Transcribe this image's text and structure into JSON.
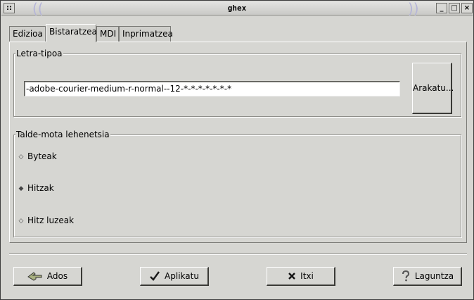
{
  "window": {
    "title": "ghex"
  },
  "titlebar": {
    "menu_glyph": "::",
    "minimize_glyph": "_",
    "maximize_glyph": "□",
    "close_glyph": "×"
  },
  "tabs": [
    {
      "label": "Edizioa",
      "active": false
    },
    {
      "label": "Bistaratzea",
      "active": true
    },
    {
      "label": "MDI",
      "active": false
    },
    {
      "label": "Inprimatzea",
      "active": false
    }
  ],
  "font_section": {
    "title": "Letra-tipoa",
    "font_value": "-adobe-courier-medium-r-normal--12-*-*-*-*-*-*-*",
    "browse_label": "Arakatu..."
  },
  "group_section": {
    "title": "Talde-mota lehenetsia",
    "options": [
      {
        "label": "Byteak",
        "selected": false
      },
      {
        "label": "Hitzak",
        "selected": true
      },
      {
        "label": "Hitz luzeak",
        "selected": false
      }
    ]
  },
  "buttons": {
    "ok": {
      "label": "Ados",
      "icon": "hand-pointing-icon"
    },
    "apply": {
      "label": "Aplikatu",
      "icon": "checkmark-icon"
    },
    "close": {
      "label": "Itxi",
      "icon": "x-icon"
    },
    "help": {
      "label": "Laguntza",
      "icon": "question-icon"
    }
  },
  "colors": {
    "background": "#d6d6d2",
    "title_deco": "#b5b5d8"
  }
}
